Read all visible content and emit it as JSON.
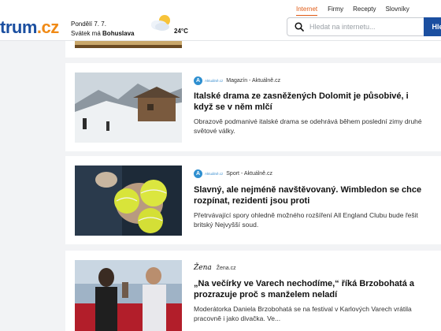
{
  "header": {
    "logo": {
      "main": "trum",
      "tld": ".cz"
    },
    "date_line": "Pondělí 7. 7.",
    "nameday_prefix": "Svátek má",
    "nameday_name": "Bohuslava",
    "weather_icon": "partly-cloudy-icon",
    "temperature": "24°C",
    "nav": [
      {
        "label": "Internet",
        "active": true
      },
      {
        "label": "Firmy",
        "active": false
      },
      {
        "label": "Recepty",
        "active": false
      },
      {
        "label": "Slovníky",
        "active": false
      }
    ],
    "search": {
      "placeholder": "Hledat na internetu...",
      "button_label": "Hle"
    }
  },
  "articles": [
    {
      "source_brand": "Aktuálně.cz",
      "source": "Magazín - Aktuálně.cz",
      "title": "Italské drama ze zasněžených Dolomit je působivé, i když se v něm mlčí",
      "perex": "Obrazově podmanivé italské drama se odehrává během poslední zimy druhé světové války."
    },
    {
      "source_brand": "Aktuálně.cz",
      "source": "Sport - Aktuálně.cz",
      "title": "Slavný, ale nejméně navštěvovaný. Wimbledon se chce rozpínat, rezidenti jsou proti",
      "perex": "Přetrvávající spory ohledně možného rozšíření All England Clubu bude řešit britský Nejvyšší soud."
    },
    {
      "source_brand": "Žena",
      "source": "Žena.cz",
      "title": "„Na večírky ve Varech nechodíme,“ říká Brzobohatá a prozrazuje proč s manželem neladí",
      "perex": "Moderátorka Daniela Brzobohatá se na festival v Karlových Varech vrátila pracovně i jako divačka. Ve..."
    }
  ],
  "colors": {
    "brand_blue": "#1b4fa0",
    "accent_orange": "#e05a14",
    "page_bg": "#f2f3f5"
  }
}
